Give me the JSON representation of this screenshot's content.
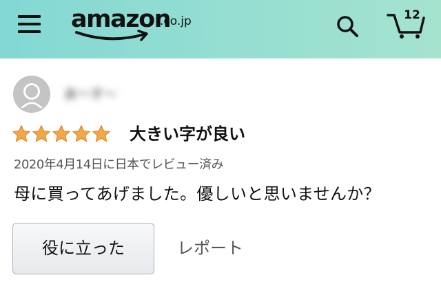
{
  "header": {
    "menu_icon": "hamburger-menu-icon",
    "logo": {
      "word": "amazon",
      "suffix": ".co.jp"
    },
    "search_icon": "search-icon",
    "cart": {
      "icon": "cart-icon",
      "count": "12"
    },
    "colors": {
      "gradient_start": "#83d8d4",
      "gradient_end": "#a5e3cf"
    }
  },
  "review": {
    "reviewer": {
      "avatar_icon": "default-user-avatar-icon",
      "name": "あ〜す〜"
    },
    "rating": {
      "value": 5,
      "max": 5,
      "star_color": "#f3a847"
    },
    "title": "大きい字が良い",
    "meta": "2020年4月14日に日本でレビュー済み",
    "body": "母に買ってあげました。優しいと思いませんか？",
    "actions": {
      "helpful_label": "役に立った",
      "report_label": "レポート"
    }
  }
}
